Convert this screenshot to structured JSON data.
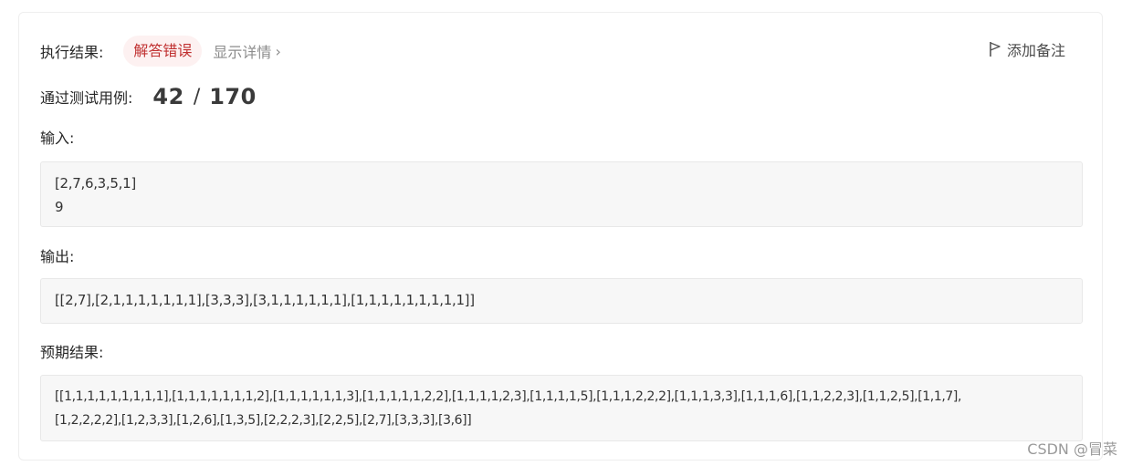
{
  "result": {
    "label": "执行结果:",
    "status": "解答错误",
    "details_link": "显示详情",
    "details_chevron": "›",
    "add_note": "添加备注"
  },
  "tests": {
    "label": "通过测试用例:",
    "passed": "42",
    "separator": "/",
    "total": "170"
  },
  "input": {
    "label": "输入:",
    "line1": "[2,7,6,3,5,1]",
    "line2": "9"
  },
  "output": {
    "label": "输出:",
    "value": "[[2,7],[2,1,1,1,1,1,1,1],[3,3,3],[3,1,1,1,1,1,1],[1,1,1,1,1,1,1,1,1]]"
  },
  "expected": {
    "label": "预期结果:",
    "line1": "[[1,1,1,1,1,1,1,1,1],[1,1,1,1,1,1,1,2],[1,1,1,1,1,1,3],[1,1,1,1,1,2,2],[1,1,1,1,2,3],[1,1,1,1,5],[1,1,1,2,2,2],[1,1,1,3,3],[1,1,1,6],[1,1,2,2,3],[1,1,2,5],[1,1,7],",
    "line2": "[1,2,2,2,2],[1,2,3,3],[1,2,6],[1,3,5],[2,2,2,3],[2,2,5],[2,7],[3,3,3],[3,6]]"
  },
  "watermark": "CSDN @冒菜",
  "colors": {
    "error_text": "#c03030",
    "error_bg": "#fdf1f1",
    "box_bg": "#f7f7f7"
  },
  "icons": {
    "note": "flag-icon",
    "details": "chevron-right-icon"
  }
}
